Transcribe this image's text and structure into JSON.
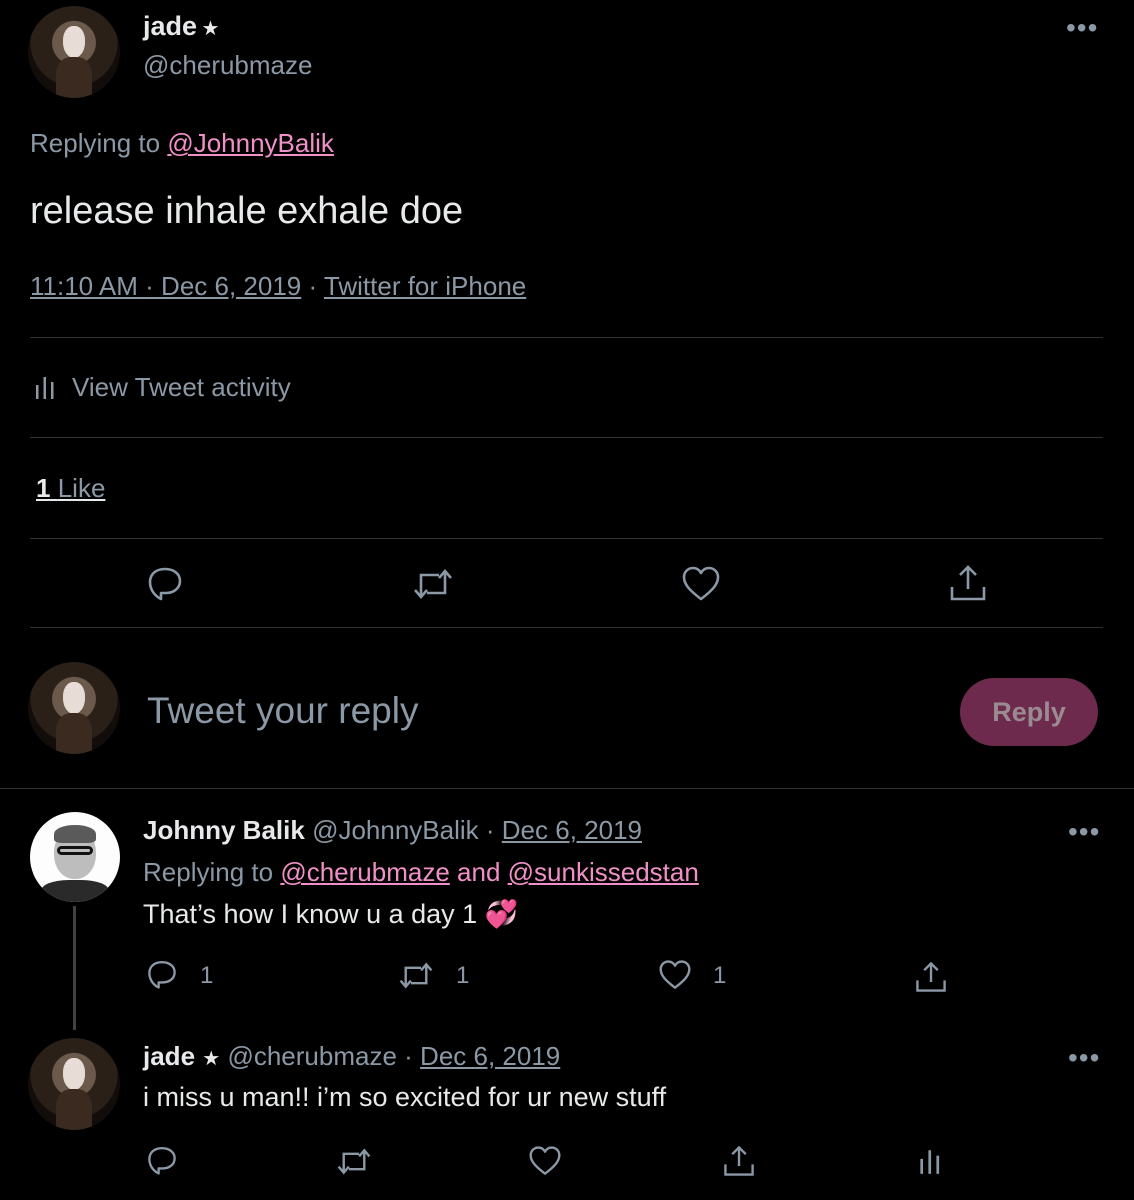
{
  "main_tweet": {
    "name": "jade",
    "badge": "★",
    "handle": "@cherubmaze",
    "replying_prefix": "Replying to",
    "replying_to": "@JohnnyBalik",
    "text": "release inhale exhale doe",
    "time": "11:10 AM",
    "date": "Dec 6, 2019",
    "source": "Twitter for iPhone",
    "activity_label": "View Tweet activity",
    "likes_count": "1",
    "likes_label": "Like"
  },
  "composer": {
    "placeholder": "Tweet your reply",
    "reply_button": "Reply"
  },
  "replies": [
    {
      "name": "Johnny Balik",
      "handle": "@JohnnyBalik",
      "date": "Dec 6, 2019",
      "replying_prefix": "Replying to",
      "replying_to_1": "@cherubmaze",
      "and": "and",
      "replying_to_2": "@sunkissedstan",
      "text": "That’s how I know u a day 1",
      "emoji": "💞",
      "reply_count": "1",
      "retweet_count": "1",
      "like_count": "1"
    },
    {
      "name": "jade",
      "badge": "★",
      "handle": "@cherubmaze",
      "date": "Dec 6, 2019",
      "text": "i miss u man!! i’m so excited for ur new stuff"
    }
  ],
  "colors": {
    "background": "#000000",
    "text": "#e7e9ea",
    "muted": "#8b98a5",
    "accent_link": "#f190c7",
    "reply_button_bg": "#6e2a4c"
  }
}
